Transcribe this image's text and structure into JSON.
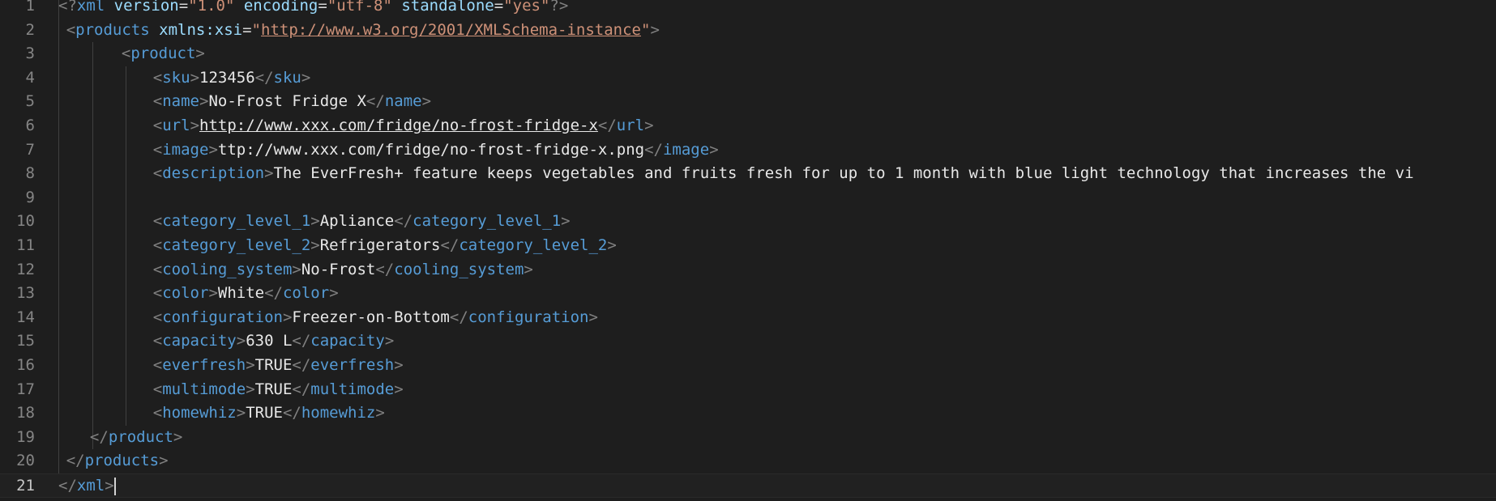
{
  "editor": {
    "language": "xml",
    "colors": {
      "background": "#1e1e1e",
      "tag": "#569cd6",
      "attribute": "#9cdcfe",
      "string": "#ce9178",
      "punctuation": "#808080",
      "text": "#e8e8e8",
      "line_number": "#858585"
    },
    "active_line": 21,
    "lines": [
      {
        "n": "1",
        "indent": 0,
        "tokens": [
          {
            "c": "p",
            "v": "<?"
          },
          {
            "c": "t",
            "v": "xml"
          },
          {
            "c": "x",
            "v": " "
          },
          {
            "c": "a",
            "v": "version"
          },
          {
            "c": "eq",
            "v": "="
          },
          {
            "c": "s",
            "v": "\"1.0\""
          },
          {
            "c": "x",
            "v": " "
          },
          {
            "c": "a",
            "v": "encoding"
          },
          {
            "c": "eq",
            "v": "="
          },
          {
            "c": "s",
            "v": "\"utf-8\""
          },
          {
            "c": "x",
            "v": " "
          },
          {
            "c": "a",
            "v": "standalone"
          },
          {
            "c": "eq",
            "v": "="
          },
          {
            "c": "s",
            "v": "\"yes\""
          },
          {
            "c": "p",
            "v": "?>"
          }
        ]
      },
      {
        "n": "2",
        "indent": 1,
        "tokens": [
          {
            "c": "p",
            "v": "<"
          },
          {
            "c": "t",
            "v": "products"
          },
          {
            "c": "x",
            "v": " "
          },
          {
            "c": "a",
            "v": "xmlns:xsi"
          },
          {
            "c": "eq",
            "v": "="
          },
          {
            "c": "s",
            "v": "\""
          },
          {
            "c": "s-u",
            "v": "http://www.w3.org/2001/XMLSchema-instance"
          },
          {
            "c": "s",
            "v": "\""
          },
          {
            "c": "p",
            "v": ">"
          }
        ]
      },
      {
        "n": "3",
        "indent": 8,
        "tokens": [
          {
            "c": "p",
            "v": "<"
          },
          {
            "c": "t",
            "v": "product"
          },
          {
            "c": "p",
            "v": ">"
          }
        ]
      },
      {
        "n": "4",
        "indent": 12,
        "tokens": [
          {
            "c": "p",
            "v": "<"
          },
          {
            "c": "t",
            "v": "sku"
          },
          {
            "c": "p",
            "v": ">"
          },
          {
            "c": "x",
            "v": "123456"
          },
          {
            "c": "p",
            "v": "</"
          },
          {
            "c": "t",
            "v": "sku"
          },
          {
            "c": "p",
            "v": ">"
          }
        ]
      },
      {
        "n": "5",
        "indent": 12,
        "tokens": [
          {
            "c": "p",
            "v": "<"
          },
          {
            "c": "t",
            "v": "name"
          },
          {
            "c": "p",
            "v": ">"
          },
          {
            "c": "x",
            "v": "No-Frost Fridge X"
          },
          {
            "c": "p",
            "v": "</"
          },
          {
            "c": "t",
            "v": "name"
          },
          {
            "c": "p",
            "v": ">"
          }
        ]
      },
      {
        "n": "6",
        "indent": 12,
        "tokens": [
          {
            "c": "p",
            "v": "<"
          },
          {
            "c": "t",
            "v": "url"
          },
          {
            "c": "p",
            "v": ">"
          },
          {
            "c": "x-u",
            "v": "http://www.xxx.com/fridge/no-frost-fridge-x"
          },
          {
            "c": "p",
            "v": "</"
          },
          {
            "c": "t",
            "v": "url"
          },
          {
            "c": "p",
            "v": ">"
          }
        ]
      },
      {
        "n": "7",
        "indent": 12,
        "tokens": [
          {
            "c": "p",
            "v": "<"
          },
          {
            "c": "t",
            "v": "image"
          },
          {
            "c": "p",
            "v": ">"
          },
          {
            "c": "x",
            "v": "ttp://www.xxx.com/fridge/no-frost-fridge-x.png"
          },
          {
            "c": "p",
            "v": "</"
          },
          {
            "c": "t",
            "v": "image"
          },
          {
            "c": "p",
            "v": ">"
          }
        ]
      },
      {
        "n": "8",
        "indent": 12,
        "tokens": [
          {
            "c": "p",
            "v": "<"
          },
          {
            "c": "t",
            "v": "description"
          },
          {
            "c": "p",
            "v": ">"
          },
          {
            "c": "x",
            "v": "The EverFresh+ feature keeps vegetables and fruits fresh for up to 1 month with blue light technology that increases the vi"
          }
        ]
      },
      {
        "n": "9",
        "indent": 12,
        "tokens": []
      },
      {
        "n": "10",
        "indent": 12,
        "tokens": [
          {
            "c": "p",
            "v": "<"
          },
          {
            "c": "t",
            "v": "category_level_1"
          },
          {
            "c": "p",
            "v": ">"
          },
          {
            "c": "x",
            "v": "Apliance"
          },
          {
            "c": "p",
            "v": "</"
          },
          {
            "c": "t",
            "v": "category_level_1"
          },
          {
            "c": "p",
            "v": ">"
          }
        ]
      },
      {
        "n": "11",
        "indent": 12,
        "tokens": [
          {
            "c": "p",
            "v": "<"
          },
          {
            "c": "t",
            "v": "category_level_2"
          },
          {
            "c": "p",
            "v": ">"
          },
          {
            "c": "x",
            "v": "Refrigerators"
          },
          {
            "c": "p",
            "v": "</"
          },
          {
            "c": "t",
            "v": "category_level_2"
          },
          {
            "c": "p",
            "v": ">"
          }
        ]
      },
      {
        "n": "12",
        "indent": 12,
        "tokens": [
          {
            "c": "p",
            "v": "<"
          },
          {
            "c": "t",
            "v": "cooling_system"
          },
          {
            "c": "p",
            "v": ">"
          },
          {
            "c": "x",
            "v": "No-Frost"
          },
          {
            "c": "p",
            "v": "</"
          },
          {
            "c": "t",
            "v": "cooling_system"
          },
          {
            "c": "p",
            "v": ">"
          }
        ]
      },
      {
        "n": "13",
        "indent": 12,
        "tokens": [
          {
            "c": "p",
            "v": "<"
          },
          {
            "c": "t",
            "v": "color"
          },
          {
            "c": "p",
            "v": ">"
          },
          {
            "c": "x",
            "v": "White"
          },
          {
            "c": "p",
            "v": "</"
          },
          {
            "c": "t",
            "v": "color"
          },
          {
            "c": "p",
            "v": ">"
          }
        ]
      },
      {
        "n": "14",
        "indent": 12,
        "tokens": [
          {
            "c": "p",
            "v": "<"
          },
          {
            "c": "t",
            "v": "configuration"
          },
          {
            "c": "p",
            "v": ">"
          },
          {
            "c": "x",
            "v": "Freezer-on-Bottom"
          },
          {
            "c": "p",
            "v": "</"
          },
          {
            "c": "t",
            "v": "configuration"
          },
          {
            "c": "p",
            "v": ">"
          }
        ]
      },
      {
        "n": "15",
        "indent": 12,
        "tokens": [
          {
            "c": "p",
            "v": "<"
          },
          {
            "c": "t",
            "v": "capacity"
          },
          {
            "c": "p",
            "v": ">"
          },
          {
            "c": "x",
            "v": "630 L"
          },
          {
            "c": "p",
            "v": "</"
          },
          {
            "c": "t",
            "v": "capacity"
          },
          {
            "c": "p",
            "v": ">"
          }
        ]
      },
      {
        "n": "16",
        "indent": 12,
        "tokens": [
          {
            "c": "p",
            "v": "<"
          },
          {
            "c": "t",
            "v": "everfresh"
          },
          {
            "c": "p",
            "v": ">"
          },
          {
            "c": "x",
            "v": "TRUE"
          },
          {
            "c": "p",
            "v": "</"
          },
          {
            "c": "t",
            "v": "everfresh"
          },
          {
            "c": "p",
            "v": ">"
          }
        ]
      },
      {
        "n": "17",
        "indent": 12,
        "tokens": [
          {
            "c": "p",
            "v": "<"
          },
          {
            "c": "t",
            "v": "multimode"
          },
          {
            "c": "p",
            "v": ">"
          },
          {
            "c": "x",
            "v": "TRUE"
          },
          {
            "c": "p",
            "v": "</"
          },
          {
            "c": "t",
            "v": "multimode"
          },
          {
            "c": "p",
            "v": ">"
          }
        ]
      },
      {
        "n": "18",
        "indent": 12,
        "tokens": [
          {
            "c": "p",
            "v": "<"
          },
          {
            "c": "t",
            "v": "homewhiz"
          },
          {
            "c": "p",
            "v": ">"
          },
          {
            "c": "x",
            "v": "TRUE"
          },
          {
            "c": "p",
            "v": "</"
          },
          {
            "c": "t",
            "v": "homewhiz"
          },
          {
            "c": "p",
            "v": ">"
          }
        ]
      },
      {
        "n": "19",
        "indent": 4,
        "tokens": [
          {
            "c": "p",
            "v": "</"
          },
          {
            "c": "t",
            "v": "product"
          },
          {
            "c": "p",
            "v": ">"
          }
        ]
      },
      {
        "n": "20",
        "indent": 1,
        "tokens": [
          {
            "c": "p",
            "v": "</"
          },
          {
            "c": "t",
            "v": "products"
          },
          {
            "c": "p",
            "v": ">"
          }
        ]
      },
      {
        "n": "21",
        "indent": 0,
        "tokens": [
          {
            "c": "p",
            "v": "</"
          },
          {
            "c": "t",
            "v": "xml"
          },
          {
            "c": "p",
            "v": ">"
          }
        ]
      }
    ]
  }
}
